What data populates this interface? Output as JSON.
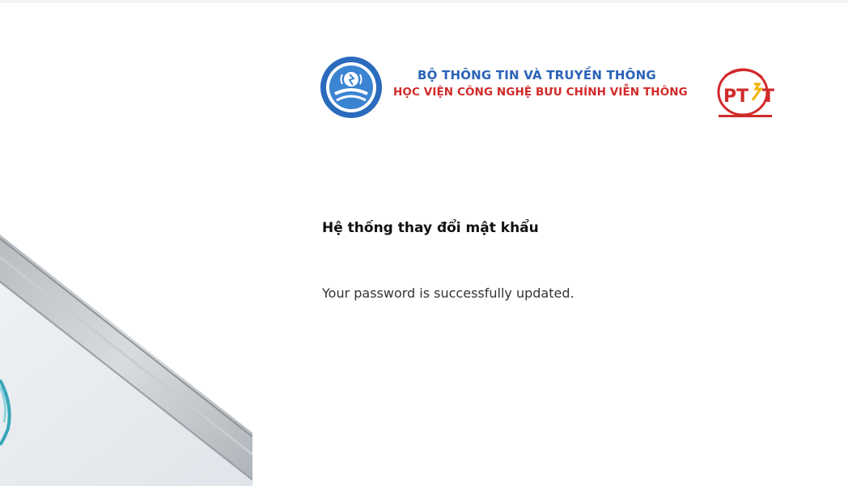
{
  "header": {
    "logo": {
      "line1": "BỘ THÔNG TIN VÀ TRUYỀN THÔNG",
      "line2": "HỌC VIỆN CÔNG NGHỆ BƯU CHÍNH VIỄN THÔNG",
      "mark_text": "PTIT",
      "line1_color": "#2b63b8",
      "line2_color": "#d12a2a"
    }
  },
  "main": {
    "title": "Hệ thống thay đổi mật khẩu",
    "message": "Your password is successfully updated."
  },
  "icons": {
    "emblem": "ministry-emblem-icon",
    "brand_mark": "ptit-logo-icon"
  }
}
